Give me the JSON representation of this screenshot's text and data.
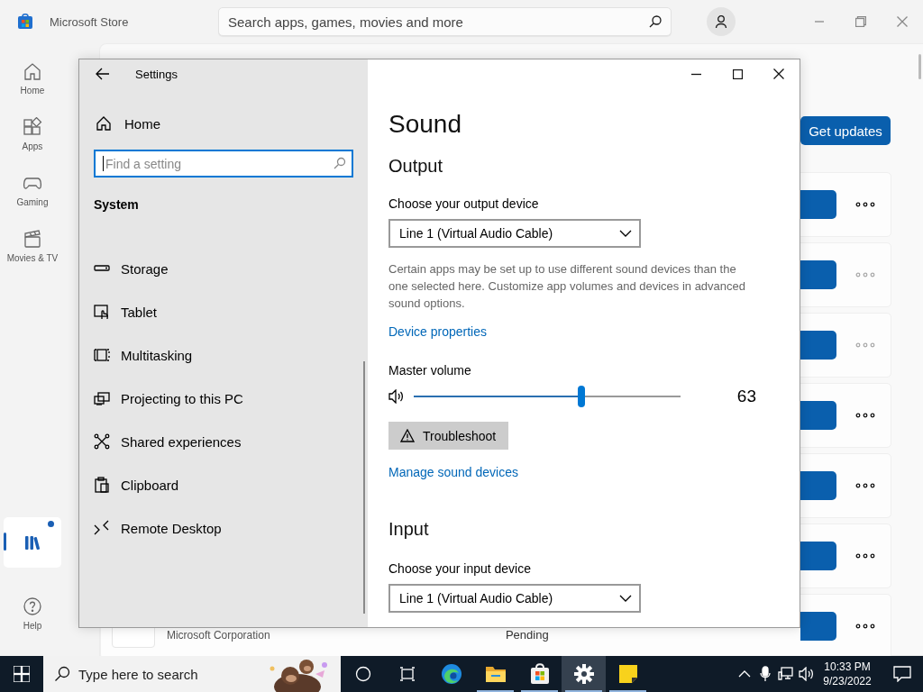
{
  "store": {
    "title": "Microsoft Store",
    "search": {
      "placeholder": "Search apps, games, movies and more"
    },
    "nav": [
      {
        "label": "Home",
        "selected": false
      },
      {
        "label": "Apps",
        "selected": false
      },
      {
        "label": "Gaming",
        "selected": false
      },
      {
        "label": "Movies & TV",
        "selected": false
      },
      {
        "selected": true,
        "badge": true
      },
      {
        "label": "Help",
        "selected": false
      }
    ],
    "get_updates": "Get updates",
    "rows": [
      {
        "menu_disabled": false
      },
      {
        "menu_disabled": true
      },
      {
        "menu_disabled": true
      },
      {
        "menu_disabled": false
      },
      {
        "menu_disabled": false
      },
      {
        "menu_disabled": false
      },
      {
        "menu_disabled": false,
        "publisher": "Microsoft Corporation",
        "status": "Pending"
      }
    ]
  },
  "settings": {
    "title": "Settings",
    "home": "Home",
    "search": {
      "placeholder": "Find a setting"
    },
    "section": "System",
    "items": [
      "Storage",
      "Tablet",
      "Multitasking",
      "Projecting to this PC",
      "Shared experiences",
      "Clipboard",
      "Remote Desktop"
    ],
    "page": {
      "title": "Sound",
      "output": {
        "heading": "Output",
        "device_label": "Choose your output device",
        "device": "Line 1 (Virtual Audio Cable)",
        "note": "Certain apps may be set up to use different sound devices than the one selected here. Customize app volumes and devices in advanced sound options.",
        "link": "Device properties",
        "volume_label": "Master volume",
        "level": 0.63,
        "reading": "63",
        "troubleshoot": "Troubleshoot",
        "manage_link": "Manage sound devices"
      },
      "input": {
        "heading": "Input",
        "device_label": "Choose your input device",
        "device": "Line 1 (Virtual Audio Cable)"
      }
    }
  },
  "taskbar": {
    "search": {
      "placeholder": "Type here to search"
    },
    "apps": [
      {
        "running": false,
        "selected": false
      },
      {
        "running": true,
        "selected": false
      },
      {
        "running": true,
        "selected": false
      },
      {
        "running": true,
        "selected": true
      },
      {
        "running": true,
        "selected": false
      }
    ],
    "time": "10:33 PM",
    "date": "9/23/2022"
  }
}
